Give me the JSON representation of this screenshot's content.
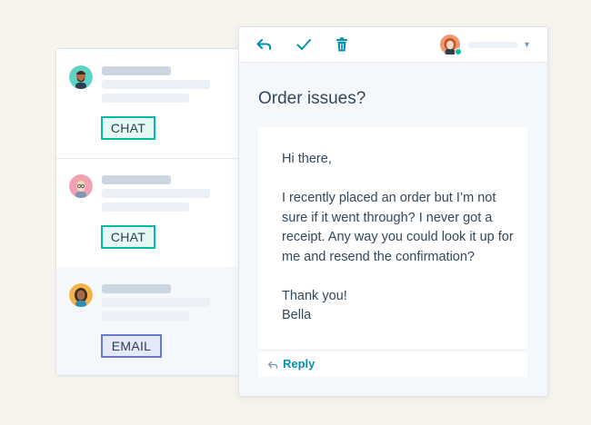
{
  "inbox": {
    "conversations": [
      {
        "channel": "CHAT",
        "selected": false
      },
      {
        "channel": "CHAT",
        "selected": false
      },
      {
        "channel": "EMAIL",
        "selected": true
      }
    ]
  },
  "toolbar": {
    "icons": [
      "reply-arrow-icon",
      "check-icon",
      "trash-icon",
      "chevron-down-icon"
    ]
  },
  "message": {
    "subject": "Order issues?",
    "greeting": "Hi there,",
    "body": "I recently placed an order but I’m not sure if it went through? I never got a receipt. Any way you could look it up for me and resend the confirmation?",
    "closing": "Thank you!",
    "signature": "Bella"
  },
  "reply": {
    "label": "Reply"
  },
  "colors": {
    "background": "#f7f4ee",
    "accent_teal": "#00bda5",
    "chat_badge_bg": "#e5f8f6",
    "email_badge_border": "#6a78d1",
    "email_badge_bg": "#e5e8f6",
    "link": "#0091ae",
    "text": "#33475b"
  }
}
